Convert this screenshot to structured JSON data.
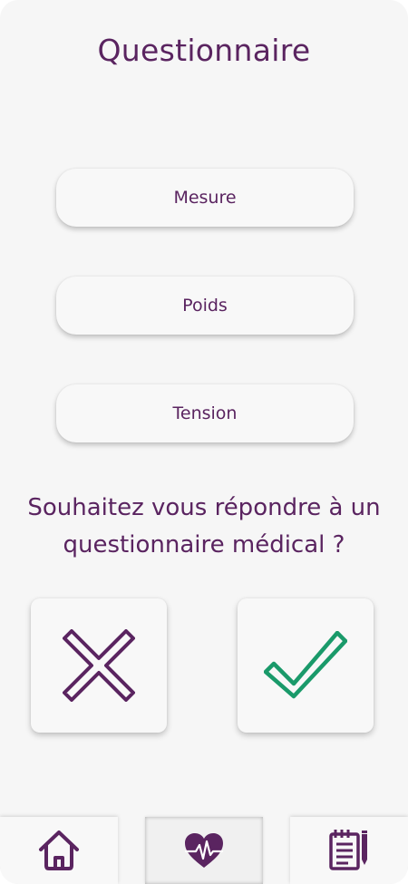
{
  "header": {
    "title": "Questionnaire"
  },
  "menu": {
    "items": [
      {
        "label": "Mesure"
      },
      {
        "label": "Poids"
      },
      {
        "label": "Tension"
      }
    ]
  },
  "prompt": {
    "line1": "Souhaitez vous répondre à un",
    "line2": "questionnaire médical ?"
  },
  "answers": {
    "no_icon": "x-icon",
    "yes_icon": "check-icon",
    "no_color": "#5a2460",
    "yes_color": "#1a9a6a"
  },
  "bottom_nav": {
    "items": [
      {
        "icon": "home-icon",
        "active": false
      },
      {
        "icon": "heart-pulse-icon",
        "active": true
      },
      {
        "icon": "notepad-pencil-icon",
        "active": false
      }
    ]
  },
  "colors": {
    "primary": "#5a2460",
    "success": "#1a9a6a",
    "background": "#f6f6f6"
  }
}
